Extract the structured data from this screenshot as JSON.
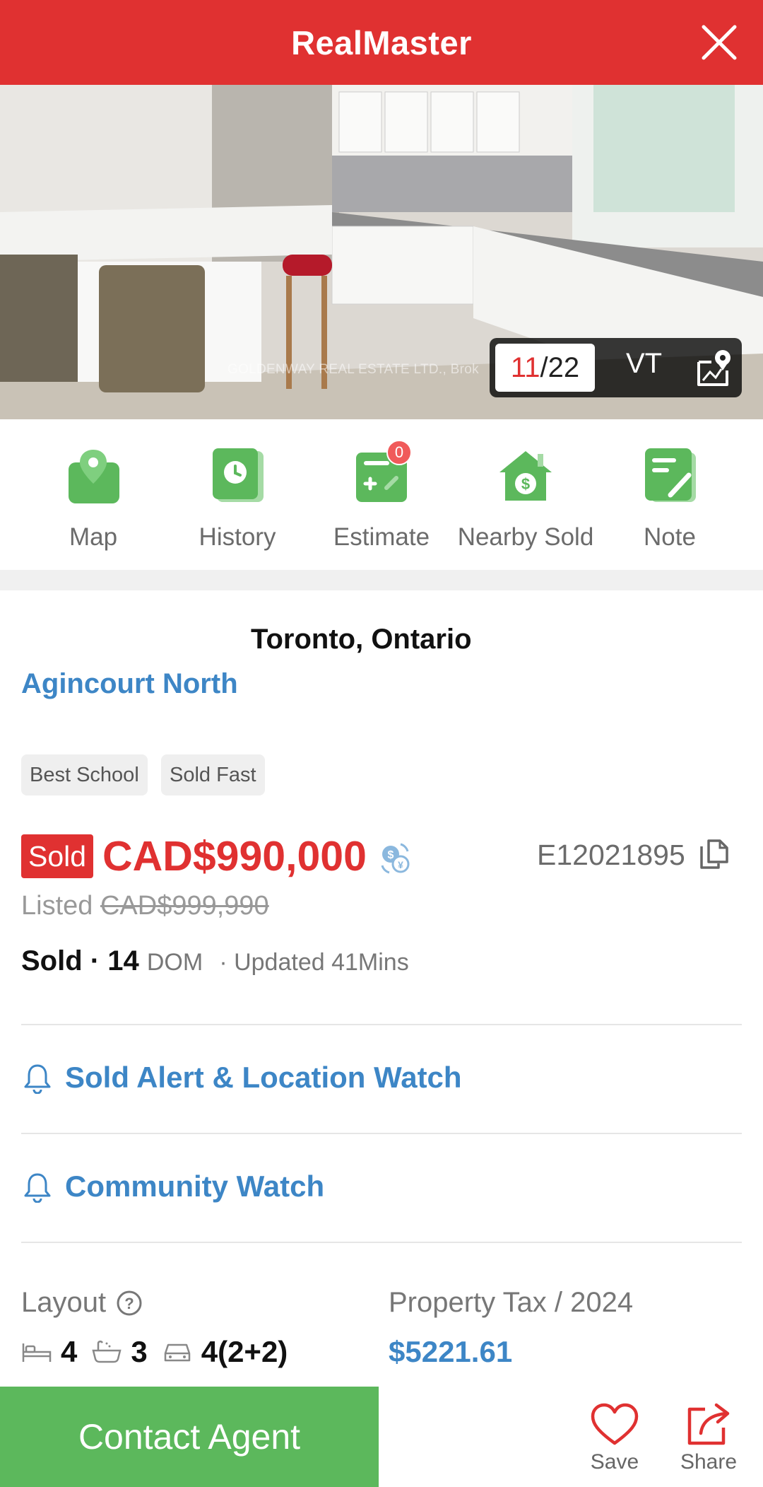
{
  "header": {
    "title": "RealMaster",
    "close_icon": "close-icon"
  },
  "gallery": {
    "watermark": "GOLDENWAY REAL ESTATE LTD., Brok",
    "current": "11",
    "separator": "/",
    "total": "22",
    "vt_label": "VT",
    "map_icon": "map-pin-icon"
  },
  "actions": [
    {
      "label": "Map",
      "icon": "map-icon"
    },
    {
      "label": "History",
      "icon": "history-clock-icon"
    },
    {
      "label": "Estimate",
      "icon": "calculator-icon",
      "badge": "0"
    },
    {
      "label": "Nearby Sold",
      "icon": "house-dollar-icon"
    },
    {
      "label": "Note",
      "icon": "note-pencil-icon"
    }
  ],
  "listing": {
    "city": "Toronto, Ontario",
    "community": "Agincourt North",
    "tags": [
      "Best School",
      "Sold Fast"
    ],
    "sold_label": "Sold",
    "price": "CAD$990,000",
    "mls": "E12021895",
    "listed_label": "Listed",
    "listed_price": "CAD$999,990",
    "status": "Sold",
    "dot": "·",
    "dom_value": "14",
    "dom_label": "DOM",
    "updated": "· Updated 41Mins"
  },
  "watches": {
    "sold_alert": "Sold Alert & Location Watch",
    "community": "Community Watch"
  },
  "details": {
    "layout_label": "Layout",
    "bedrooms": "4",
    "bathrooms": "3",
    "parking": "4(2+2)",
    "tax_label": "Property Tax / 2024",
    "tax_value": "$5221.61"
  },
  "footer": {
    "contact": "Contact Agent",
    "save": "Save",
    "share": "Share"
  },
  "colors": {
    "brand_red": "#e03131",
    "link_blue": "#3d86c6",
    "action_green": "#5cb85c"
  }
}
